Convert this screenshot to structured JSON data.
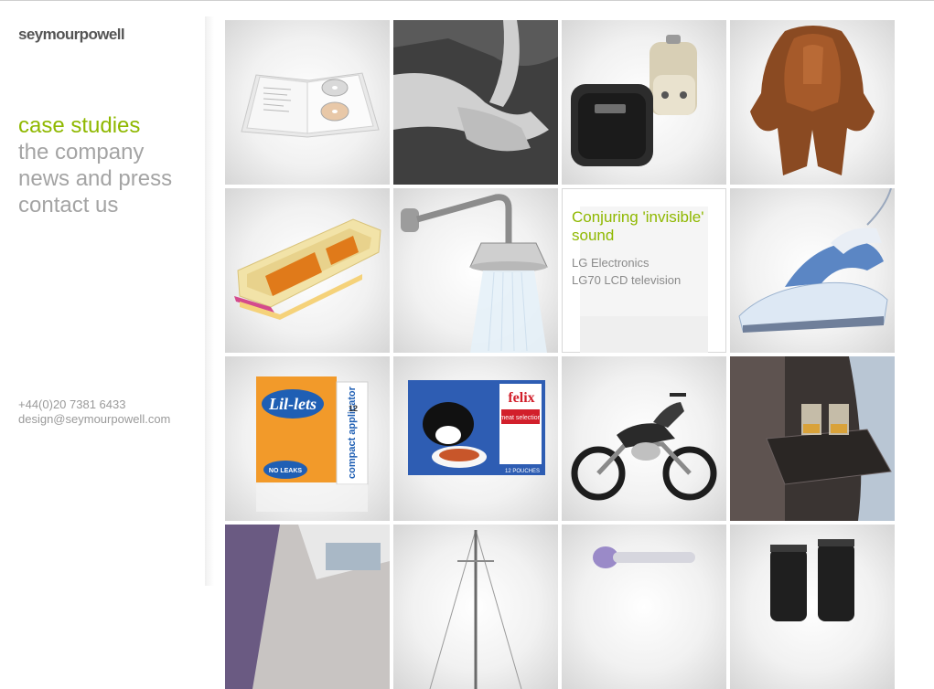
{
  "brand": {
    "logo": "seymourpowell"
  },
  "nav": {
    "items": [
      {
        "label": "case studies",
        "active": true
      },
      {
        "label": "the company",
        "active": false
      },
      {
        "label": "news and press",
        "active": false
      },
      {
        "label": "contact us",
        "active": false
      }
    ]
  },
  "contact": {
    "phone": "+44(0)20 7381 6433",
    "email": "design@seymourpowell.com"
  },
  "colors": {
    "accent": "#8fb800",
    "nav": "#a4a4a4",
    "logo": "#555555"
  },
  "featured": {
    "title": "Conjuring 'invisible' sound",
    "client": "LG Electronics",
    "product": "LG70 LCD television"
  },
  "tiles": [
    {
      "icon": "open-book-dvd-image"
    },
    {
      "icon": "grey-handle-image"
    },
    {
      "icon": "cube-speakers-image"
    },
    {
      "icon": "leather-saddle-image"
    },
    {
      "icon": "orange-compact-case-image"
    },
    {
      "icon": "shower-head-image"
    },
    {
      "icon": "lg-tv-featured-tile"
    },
    {
      "icon": "steam-iron-image"
    },
    {
      "icon": "lil-lets-box-image",
      "text_lines": [
        "Lil-lets",
        "compact applicator",
        "NO LEAKS",
        "12"
      ]
    },
    {
      "icon": "felix-pack-image",
      "text_lines": [
        "felix",
        "meat selection",
        "12 POUCHES"
      ]
    },
    {
      "icon": "motorbike-image"
    },
    {
      "icon": "aircraft-seat-table-image"
    },
    {
      "icon": "cabin-interior-image"
    },
    {
      "icon": "yacht-mast-image"
    },
    {
      "icon": "purple-device-image"
    },
    {
      "icon": "black-binoculars-image"
    }
  ]
}
